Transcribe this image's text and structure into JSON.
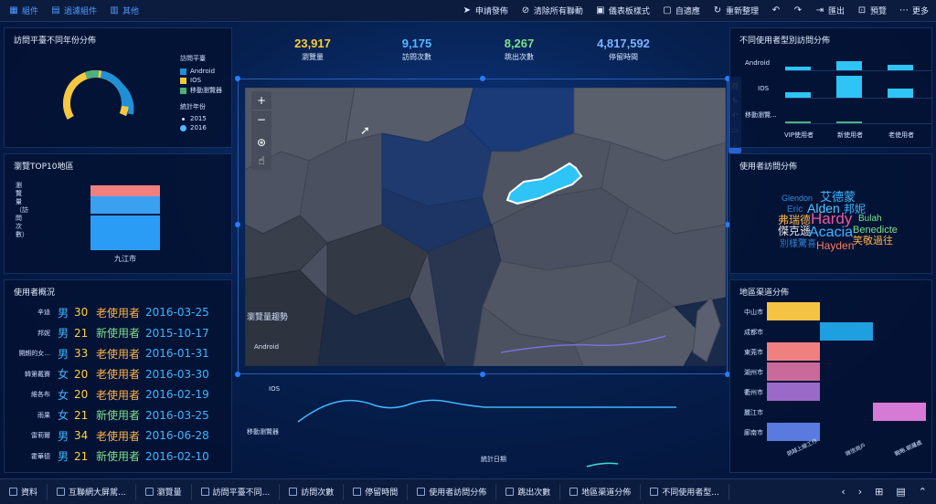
{
  "toolbar": {
    "left": [
      {
        "label": "組件",
        "icon": "component-icon"
      },
      {
        "label": "過濾組件",
        "icon": "filter-icon"
      },
      {
        "label": "其他",
        "icon": "other-icon"
      }
    ],
    "right": [
      {
        "label": "申請發佈",
        "icon": "send-icon"
      },
      {
        "label": "清除所有聯動",
        "icon": "clear-link-icon"
      },
      {
        "label": "儀表板樣式",
        "icon": "style-icon"
      },
      {
        "label": "自適應",
        "icon": "fit-icon"
      },
      {
        "label": "重新整理",
        "icon": "refresh-icon"
      },
      {
        "label": "",
        "icon": "undo-icon"
      },
      {
        "label": "",
        "icon": "redo-icon"
      },
      {
        "label": "匯出",
        "icon": "export-icon"
      },
      {
        "label": "預覽",
        "icon": "preview-icon"
      },
      {
        "label": "更多",
        "icon": "more-icon"
      }
    ]
  },
  "panels": {
    "age_dist": "訪問平臺不同年份分佈",
    "top10": "瀏覽TOP10地區",
    "users": "使用者概況",
    "user_type": "不同使用者型別訪問分佈",
    "visit_dist": "使用者訪問分佈",
    "channel": "地區渠道分佈",
    "trend": "瀏覽量趨勢"
  },
  "donut_legend": {
    "platform_title": "訪問平臺",
    "platforms": [
      {
        "name": "Android",
        "color": "#1e90d8"
      },
      {
        "name": "IOS",
        "color": "#f5c842"
      },
      {
        "name": "移動瀏覽器",
        "color": "#4caf7d"
      }
    ],
    "year_title": "統計年份",
    "years": [
      "2015",
      "2016"
    ]
  },
  "top10": {
    "ylabel": "瀏覽量（訪問次數）",
    "category": "九江市"
  },
  "kpis": [
    {
      "value": "23,917",
      "label": "瀏覽量",
      "color": "#ffcc33"
    },
    {
      "value": "9,175",
      "label": "訪問次數",
      "color": "#55b8ff"
    },
    {
      "value": "8,267",
      "label": "跳出次數",
      "color": "#7fe08a"
    },
    {
      "value": "4,817,592",
      "label": "停留時間",
      "color": "#7db4ff"
    }
  ],
  "users": [
    {
      "name": "辛迪",
      "sex": "男",
      "age": "30",
      "type": "老使用者",
      "date": "2016-03-25",
      "color": "#ffb347"
    },
    {
      "name": "邦妮",
      "sex": "男",
      "age": "21",
      "type": "新使用者",
      "date": "2015-10-17",
      "color": "#7fe08a"
    },
    {
      "name": "開朗的女...",
      "sex": "男",
      "age": "33",
      "type": "老使用者",
      "date": "2016-01-31",
      "color": "#ffb347"
    },
    {
      "name": "韓第戴賽",
      "sex": "女",
      "age": "20",
      "type": "老使用者",
      "date": "2016-03-30",
      "color": "#ffb347"
    },
    {
      "name": "維各布",
      "sex": "女",
      "age": "20",
      "type": "老使用者",
      "date": "2016-02-19",
      "color": "#ffb347"
    },
    {
      "name": "雨果",
      "sex": "女",
      "age": "21",
      "type": "新使用者",
      "date": "2016-03-25",
      "color": "#7fe08a"
    },
    {
      "name": "雷莉爾",
      "sex": "男",
      "age": "34",
      "type": "老使用者",
      "date": "2016-06-28",
      "color": "#ffb347"
    },
    {
      "name": "霍華德",
      "sex": "男",
      "age": "21",
      "type": "新使用者",
      "date": "2016-02-10",
      "color": "#7fe08a"
    }
  ],
  "user_type": {
    "rows": [
      "Android",
      "IOS",
      "移動瀏覽..."
    ],
    "cols": [
      "VIP使用者",
      "新使用者",
      "老使用者"
    ]
  },
  "trend": {
    "rows": [
      "Android",
      "IOS",
      "移動瀏覽器"
    ],
    "xlabel": "統計日期"
  },
  "wordcloud": [
    {
      "text": "Glendon",
      "color": "#3a8fd8"
    },
    {
      "text": "艾德蒙",
      "color": "#3fb6ff"
    },
    {
      "text": "Eric",
      "color": "#2e7fd0"
    },
    {
      "text": "Alden",
      "color": "#55c8ff"
    },
    {
      "text": "邦妮",
      "color": "#3fb6ff"
    },
    {
      "text": "弗瑞德",
      "color": "#ffb347"
    },
    {
      "text": "Hardy",
      "color": "#e85aa0"
    },
    {
      "text": "Bulah",
      "color": "#7fe08a"
    },
    {
      "text": "傑克遜",
      "color": "#e6e6e6"
    },
    {
      "text": "Acacia",
      "color": "#3fb6ff"
    },
    {
      "text": "Benedicte",
      "color": "#7fe08a"
    },
    {
      "text": "笑敬過往",
      "color": "#ffb347"
    },
    {
      "text": "別樣驚喜",
      "color": "#2e7fd0"
    },
    {
      "text": "Hayden",
      "color": "#ff7a59"
    }
  ],
  "channel": {
    "cities": [
      "中山市",
      "成都市",
      "東莞市",
      "湖州市",
      "衢州市",
      "麗江市",
      "廊南市"
    ],
    "xcats": [
      "朋越上線工作",
      "微信商戶",
      "戰略.朝邏處"
    ]
  },
  "bottom_tabs": [
    {
      "label": "資料",
      "icon": "data-icon"
    },
    {
      "label": "互聯網大屏駕...",
      "icon": "tab-icon"
    },
    {
      "label": "瀏覽量",
      "icon": "tab-icon"
    },
    {
      "label": "訪問平臺不同...",
      "icon": "tab-icon"
    },
    {
      "label": "訪問次數",
      "icon": "tab-icon"
    },
    {
      "label": "停留時間",
      "icon": "tab-icon"
    },
    {
      "label": "使用者訪問分佈",
      "icon": "tab-icon"
    },
    {
      "label": "跳出次數",
      "icon": "tab-icon"
    },
    {
      "label": "地區渠道分佈",
      "icon": "tab-icon"
    },
    {
      "label": "不同使用者型...",
      "icon": "tab-icon"
    }
  ]
}
